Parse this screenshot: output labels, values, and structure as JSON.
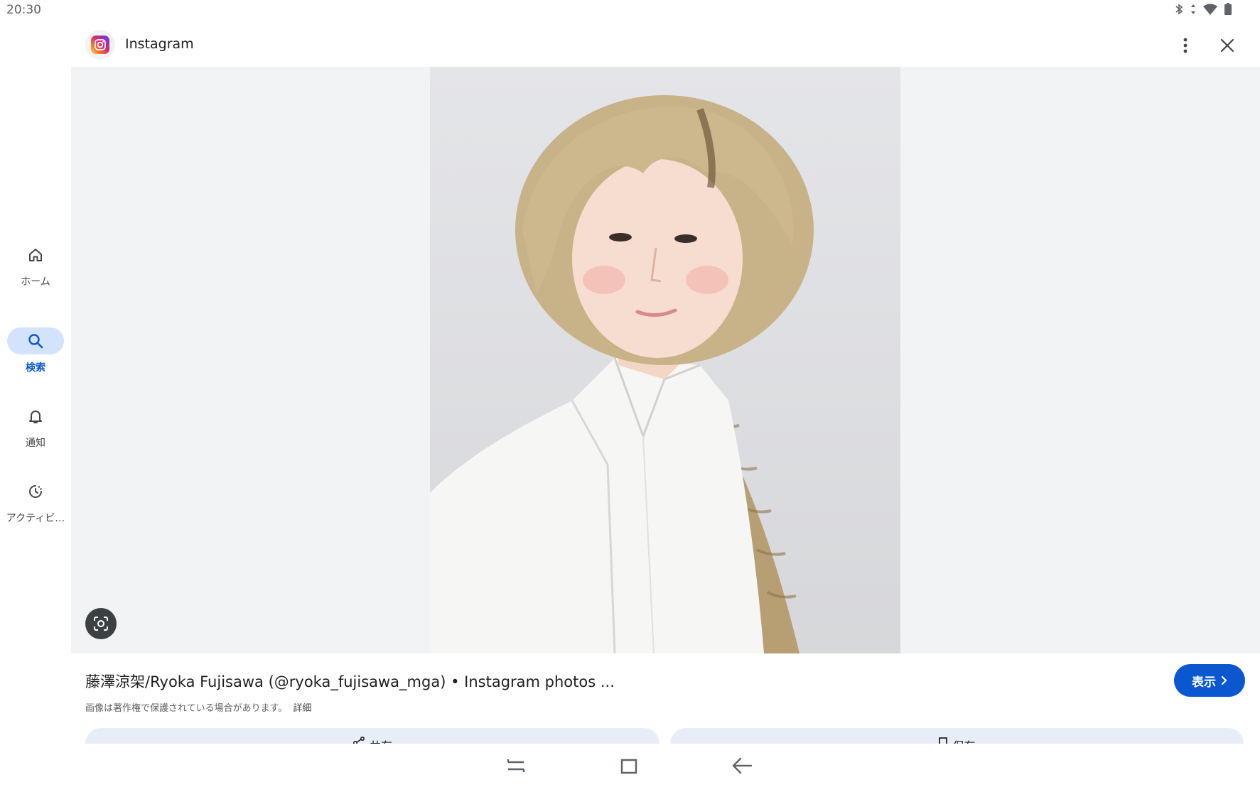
{
  "status_bar": {
    "time": "20:30",
    "icons": [
      "bluetooth-icon",
      "data-arrows-icon",
      "wifi-icon",
      "battery-icon"
    ]
  },
  "nav_rail": {
    "items": [
      {
        "label": "ホーム",
        "icon": "home-icon",
        "active": false
      },
      {
        "label": "検索",
        "icon": "search-icon",
        "active": true
      },
      {
        "label": "通知",
        "icon": "bell-icon",
        "active": false
      },
      {
        "label": "アクティビ…",
        "icon": "activity-icon",
        "active": false
      }
    ]
  },
  "header": {
    "app_name": "Instagram",
    "logo_icon": "instagram-logo-icon"
  },
  "viewer": {
    "lens_icon": "lens-icon"
  },
  "result": {
    "title": "藤澤涼架/Ryoka Fujisawa (@ryoka_fujisawa_mga) • Instagram photos ...",
    "copyright": "画像は著作権で保護されている場合があります。",
    "details_link": "詳細",
    "view_label": "表示"
  },
  "actions": {
    "share_label": "共有",
    "save_label": "保存"
  },
  "colors": {
    "accent": "#0b57d0",
    "active_pill": "#d3e3fd",
    "viewer_bg": "#f1f3f4"
  }
}
